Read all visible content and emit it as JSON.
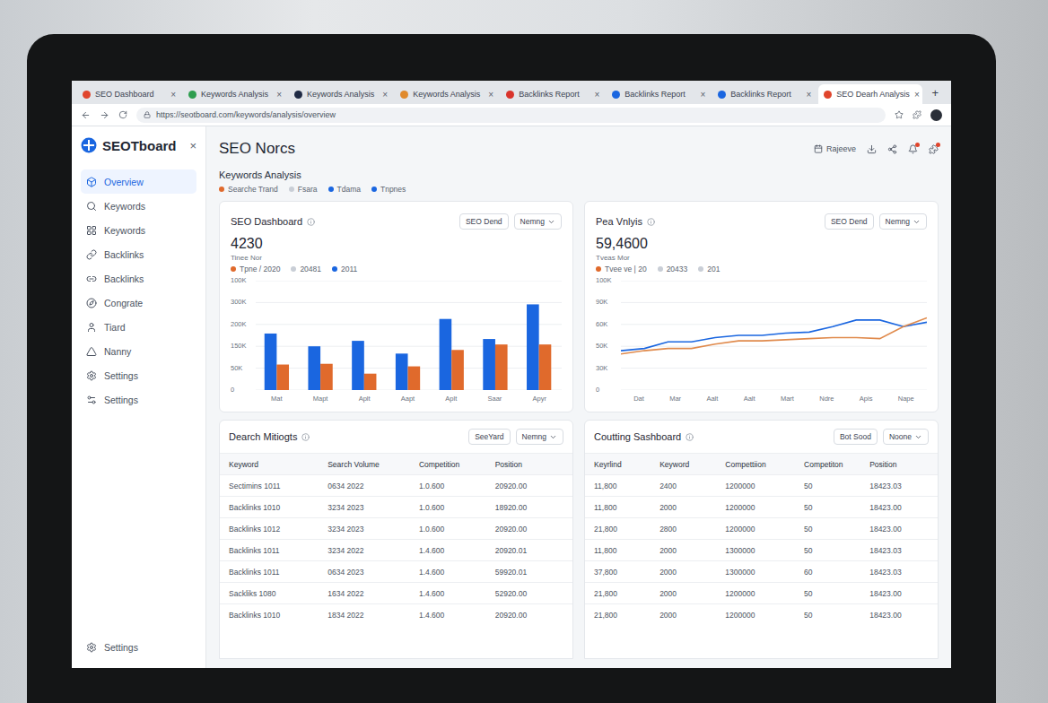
{
  "browser": {
    "tabs": [
      {
        "label": "SEO Dashboard",
        "selected": false,
        "color": "#e0452c"
      },
      {
        "label": "Keywords Analysis",
        "selected": false,
        "color": "#2e9e4f"
      },
      {
        "label": "Keywords Analysis",
        "selected": false,
        "color": "#1f2a44"
      },
      {
        "label": "Keywords Analysis",
        "selected": false,
        "color": "#e08a2c"
      },
      {
        "label": "Backlinks Report",
        "selected": false,
        "color": "#d9342b"
      },
      {
        "label": "Backlinks Report",
        "selected": false,
        "color": "#1a66e0"
      },
      {
        "label": "Backlinks Report",
        "selected": false,
        "color": "#1a66e0"
      },
      {
        "label": "SEO Dearh Analysis",
        "selected": true,
        "color": "#e0452c"
      }
    ],
    "close": "×",
    "new_tab": "+",
    "url": "https://seotboard.com/keywords/analysis/overview"
  },
  "sidebar": {
    "logo": "SEOTboard",
    "close": "×",
    "items": [
      {
        "label": "Overview",
        "selected": true
      },
      {
        "label": "Keywords",
        "selected": false
      },
      {
        "label": "Keywords",
        "selected": false
      },
      {
        "label": "Backlinks",
        "selected": false
      },
      {
        "label": "Backlinks",
        "selected": false
      },
      {
        "label": "Congrate",
        "selected": false
      },
      {
        "label": "Tiard",
        "selected": false
      },
      {
        "label": "Nanny",
        "selected": false
      },
      {
        "label": "Settings",
        "selected": false
      },
      {
        "label": "Settings",
        "selected": false
      }
    ],
    "footer": "Settings"
  },
  "header": {
    "title": "SEO Norcs",
    "action": "Rajeeve",
    "icons": [
      {
        "badge": false
      },
      {
        "badge": false
      },
      {
        "badge": true
      },
      {
        "badge": true
      }
    ]
  },
  "section": {
    "title": "Keywords Analysis",
    "legend": [
      {
        "label": "Searche Trand",
        "color": "#e06a2c"
      },
      {
        "label": "Fsara",
        "color": "#c9ced6"
      },
      {
        "label": "Tdama",
        "color": "#1a66e0"
      },
      {
        "label": "Tnpnes",
        "color": "#1a66e0"
      }
    ]
  },
  "bar_card": {
    "title": "SEO Dashboard",
    "buttons": [
      "SEO Dend",
      "Nemng"
    ],
    "value": "4230",
    "subtitle": "Tinee Nor",
    "legend": [
      {
        "label": "Tpne / 2020",
        "color": "#e06a2c"
      },
      {
        "label": "20481",
        "color": "#c9ced6"
      },
      {
        "label": "2011",
        "color": "#1a66e0"
      }
    ],
    "ticks": [
      "100K",
      "300K",
      "200K",
      "150K",
      "50K",
      "0"
    ],
    "labels": [
      "Mat",
      "Mapt",
      "Aplt",
      "Aapt",
      "Aplt",
      "Saar",
      "Apyr"
    ],
    "series": [
      {
        "values": [
          155,
          120,
          135,
          100,
          195,
          140,
          235
        ],
        "color": "#1a66e0"
      },
      {
        "values": [
          70,
          72,
          45,
          65,
          110,
          125,
          125
        ],
        "color": "#e06a2c"
      }
    ]
  },
  "line_card": {
    "title": "Pea Vnlyis",
    "buttons": [
      "SEO Dend",
      "Nemng"
    ],
    "value": "59,4600",
    "subtitle": "Tveas Mor",
    "legend": [
      {
        "label": "Tvee ve | 20",
        "color": "#e06a2c"
      },
      {
        "label": "20433",
        "color": "#c9ced6"
      },
      {
        "label": "201",
        "color": "#c9ced6"
      }
    ],
    "ticks": [
      "100K",
      "90K",
      "60K",
      "50K",
      "30K",
      "0"
    ],
    "labels": [
      "Dat",
      "Mar",
      "Aalt",
      "Aalt",
      "Mart",
      "Ndre",
      "Apis",
      "Nape"
    ],
    "series": [
      {
        "values": [
          36,
          38,
          44,
          44,
          48,
          50,
          50,
          52,
          53,
          58,
          64,
          64,
          58,
          62
        ],
        "color": "#1a66e0"
      },
      {
        "values": [
          33,
          36,
          38,
          38,
          42,
          45,
          45,
          46,
          47,
          48,
          48,
          47,
          58,
          66
        ],
        "color": "#e08a4c"
      }
    ]
  },
  "search_table": {
    "title": "Dearch Mitiogts",
    "buttons": [
      "SeeYard",
      "Nemng"
    ],
    "columns": [
      "Keyword",
      "Search Volume",
      "Competition",
      "Position"
    ],
    "rows": [
      [
        "Sectimins 1011",
        "0634 2022",
        "1.0.600",
        "20920.00"
      ],
      [
        "Backlinks 1010",
        "3234 2023",
        "1.0.600",
        "18920.00"
      ],
      [
        "Backlinks 1012",
        "3234 2023",
        "1.0.600",
        "20920.00"
      ],
      [
        "Backlinks 1011",
        "3234 2022",
        "1.4.600",
        "20920.01"
      ],
      [
        "Backlinks 1011",
        "0634 2023",
        "1.4.600",
        "59920.01"
      ],
      [
        "Sackliks 1080",
        "1634 2022",
        "1.4.600",
        "52920.00"
      ],
      [
        "Backlinks 1010",
        "1834 2022",
        "1.4.600",
        "20920.00"
      ]
    ]
  },
  "counting_table": {
    "title": "Coutting Sashboard",
    "buttons": [
      "Bot Sood",
      "Noone"
    ],
    "columns": [
      "Keyrlind",
      "Keyword",
      "Compettiion",
      "Competiton",
      "Position"
    ],
    "rows": [
      [
        "11,800",
        "2400",
        "1200000",
        "50",
        "18423.03"
      ],
      [
        "11,800",
        "2000",
        "1200000",
        "50",
        "18423.00"
      ],
      [
        "21,800",
        "2800",
        "1200000",
        "50",
        "18423.00"
      ],
      [
        "11,800",
        "2000",
        "1300000",
        "50",
        "18423.03"
      ],
      [
        "37,800",
        "2000",
        "1300000",
        "60",
        "18423.03"
      ],
      [
        "21,800",
        "2000",
        "1200000",
        "50",
        "18423.00"
      ],
      [
        "21,800",
        "2000",
        "1200000",
        "50",
        "18423.00"
      ]
    ]
  }
}
